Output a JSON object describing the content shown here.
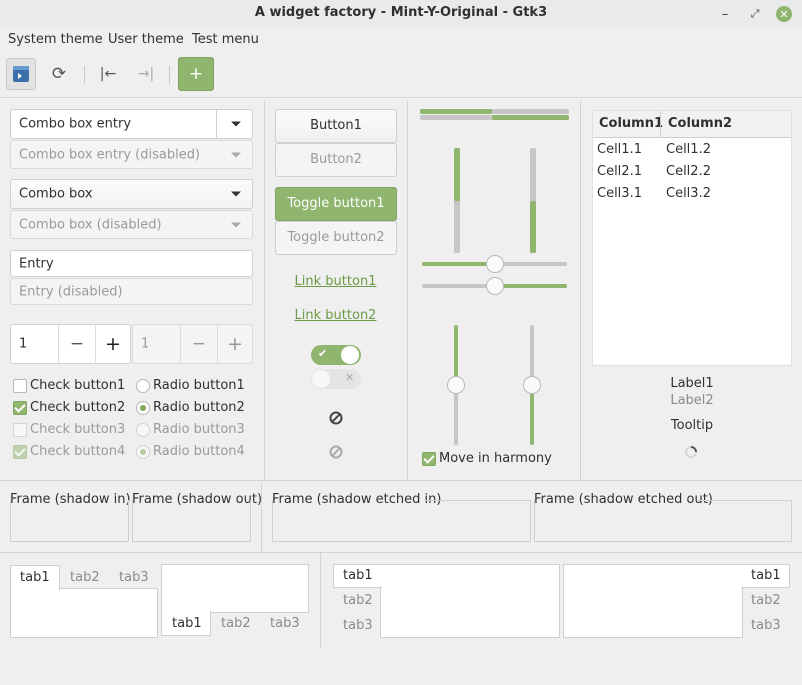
{
  "window": {
    "title": "A widget factory - Mint-Y-Original - Gtk3"
  },
  "menubar": {
    "items": [
      "System theme",
      "User theme",
      "Test menu"
    ]
  },
  "col1": {
    "combo_entry": "Combo box entry",
    "combo_entry_disabled": "Combo box entry (disabled)",
    "combo_box": "Combo box",
    "combo_box_disabled": "Combo box (disabled)",
    "entry": "Entry",
    "entry_disabled": "Entry (disabled)",
    "spin1": "1",
    "spin2": "1",
    "minus": "−",
    "plus": "+",
    "checks": [
      "Check button1",
      "Check button2",
      "Check button3",
      "Check button4"
    ],
    "radios": [
      "Radio button1",
      "Radio button2",
      "Radio button3",
      "Radio button4"
    ]
  },
  "col2": {
    "button1": "Button1",
    "button2": "Button2",
    "toggle1": "Toggle button1",
    "toggle2": "Toggle button2",
    "link1": "Link button1",
    "link2": "Link button2"
  },
  "col3": {
    "harmony": "Move in harmony",
    "progress": [
      0.48,
      0.52
    ],
    "vprogress": [
      0.5,
      0.5
    ],
    "hscale": [
      0.5,
      0.5
    ],
    "vscale": [
      0.5,
      0.5
    ]
  },
  "col4": {
    "headers": [
      "Column1",
      "Column2"
    ],
    "rows": [
      [
        "Cell1.1",
        "Cell1.2"
      ],
      [
        "Cell2.1",
        "Cell2.2"
      ],
      [
        "Cell3.1",
        "Cell3.2"
      ]
    ],
    "label1": "Label1",
    "label2": "Label2",
    "tooltip": "Tooltip"
  },
  "frames": [
    "Frame (shadow in)",
    "Frame (shadow out)",
    "Frame (shadow etched in)",
    "Frame (shadow etched out)"
  ],
  "tabs": [
    "tab1",
    "tab2",
    "tab3"
  ],
  "colors": {
    "accent": "#8fb56f",
    "accent_dark": "#7fa55f",
    "link": "#6c9a45"
  }
}
